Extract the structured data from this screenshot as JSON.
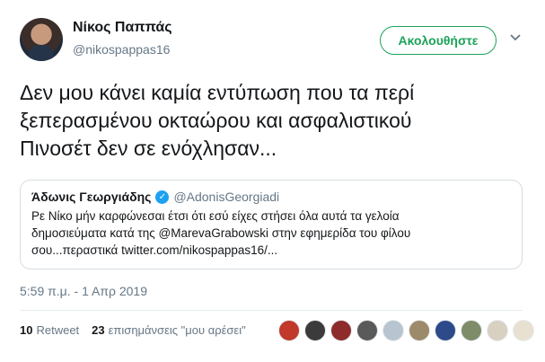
{
  "author": {
    "name": "Νίκος Παππάς",
    "handle": "@nikospappas16"
  },
  "follow_button": {
    "label": "Ακολουθήστε"
  },
  "tweet": {
    "text": "Δεν μου κάνει καμία εντύπωση που τα περί\nξεπερασμένου οκταώρου και ασφαλιστικού\nΠινοσέτ δεν σε ενόχλησαν..."
  },
  "quoted_tweet": {
    "name": "Άδωνις Γεωργιάδης",
    "handle": "@AdonisGeorgiadi",
    "text": "Ρε Νίκο μήν καρφώνεσαι έτσι ότι εσύ είχες στήσει όλα αυτά τα γελοία\nδημοσιεύματα κατά της @MarevaGrabowski στην εφημερίδα του φίλου\nσου...περαστικά twitter.com/nikospappas16/..."
  },
  "timestamp": "5:59 π.μ. - 1 Απρ 2019",
  "stats": {
    "retweets_count": "10",
    "retweets_label": "Retweet",
    "likes_count": "23",
    "likes_label": "επισημάνσεις \"μου αρέσει\""
  },
  "likers": [
    {
      "color": "#c0392b"
    },
    {
      "color": "#3b3b3b"
    },
    {
      "color": "#8e2c2c"
    },
    {
      "color": "#5a5a5a"
    },
    {
      "color": "#b8c4cf"
    },
    {
      "color": "#9c8a6a"
    },
    {
      "color": "#2d4a8a"
    },
    {
      "color": "#7f8c6a"
    },
    {
      "color": "#d8d0c0"
    },
    {
      "color": "#e8e0d0"
    }
  ]
}
